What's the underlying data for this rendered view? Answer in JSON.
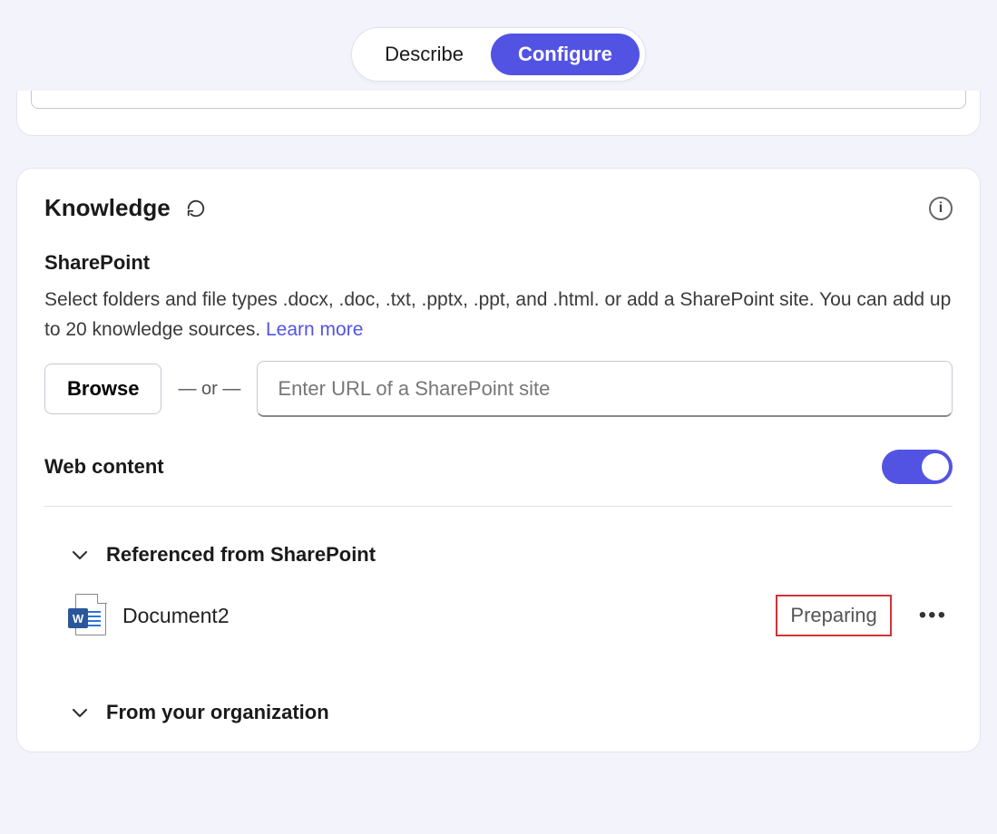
{
  "segmented": {
    "describe": "Describe",
    "configure": "Configure"
  },
  "knowledge": {
    "title": "Knowledge",
    "sharepoint_heading": "SharePoint",
    "description_1": "Select folders and file types .docx, .doc, .txt, .pptx, .ppt, and .html. or add a SharePoint site. You can add up to 20 knowledge sources. ",
    "learn_more": "Learn more",
    "browse_label": "Browse",
    "or_text": "—  or  —",
    "url_placeholder": "Enter URL of a SharePoint site",
    "web_content_label": "Web content",
    "web_content_on": true,
    "sections": {
      "referenced": "Referenced from SharePoint",
      "from_org": "From your organization"
    },
    "documents": [
      {
        "name": "Document2",
        "status": "Preparing",
        "type": "word"
      }
    ]
  }
}
